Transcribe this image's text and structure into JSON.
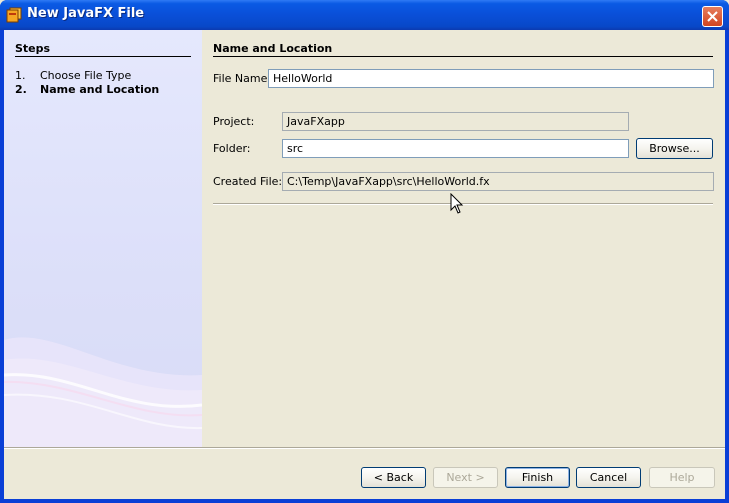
{
  "window": {
    "title": "New JavaFX File"
  },
  "steps": {
    "heading": "Steps",
    "items": [
      {
        "num": "1.",
        "label": "Choose File Type"
      },
      {
        "num": "2.",
        "label": "Name and Location"
      }
    ]
  },
  "panel": {
    "heading": "Name and Location",
    "file_name_label": "File Name:",
    "file_name_value": "HelloWorld",
    "project_label": "Project:",
    "project_value": "JavaFXapp",
    "folder_label": "Folder:",
    "folder_value": "src",
    "browse_label": "Browse...",
    "created_file_label": "Created File:",
    "created_file_value": "C:\\Temp\\JavaFXapp\\src\\HelloWorld.fx"
  },
  "buttons": {
    "back": "< Back",
    "next": "Next >",
    "finish": "Finish",
    "cancel": "Cancel",
    "help": "Help"
  },
  "colors": {
    "titlebar": "#0a4fd8",
    "dialog_bg": "#ece9d8",
    "steps_bg": "#dcdff9"
  }
}
